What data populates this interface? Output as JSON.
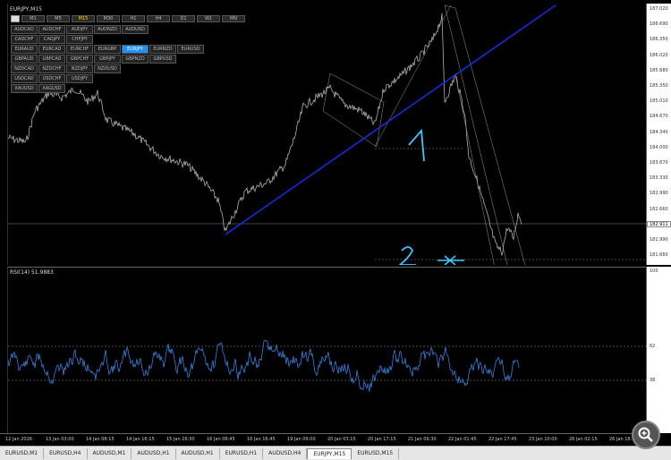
{
  "chart": {
    "title": "EURJPY,M15",
    "timeframes": [
      "M1",
      "M5",
      "M15",
      "M30",
      "H1",
      "H4",
      "D1",
      "W1",
      "MN"
    ],
    "active_timeframe": "M15",
    "pairs": [
      [
        "AUDCAD",
        "AUDCHF",
        "AUDJPY",
        "AUDNZD",
        "AUDUSD"
      ],
      [
        "CADCHF",
        "CADJPY",
        "CHFJPY"
      ],
      [
        "EURAUD",
        "EURCAD",
        "EURCHF",
        "EURGBP",
        "EURJPY",
        "EURNZD",
        "EURUSD"
      ],
      [
        "GBPAUD",
        "GBPCAD",
        "GBPCHF",
        "GBPJPY",
        "GBPNZD",
        "GBPUSD"
      ],
      [
        "NZDCAD",
        "NZDCHF",
        "NZDJPY",
        "NZDUSD"
      ],
      [
        "USDCAD",
        "USDCHF",
        "USDJPY"
      ],
      [
        "XAUUSD",
        "XAGUSD"
      ]
    ],
    "active_pair": "EURJPY",
    "price_ticks": [
      "187.020",
      "186.690",
      "186.350",
      "186.020",
      "185.680",
      "185.350",
      "185.010",
      "184.670",
      "184.340",
      "184.000",
      "183.670",
      "183.330",
      "182.990",
      "182.660",
      "182.330",
      "181.990",
      "181.660"
    ],
    "current_price": "182.911",
    "annotations": {
      "one": "1",
      "two": "2",
      "x": "x"
    }
  },
  "rsi": {
    "title": "RSI(14) 51.9883",
    "ticks": [
      "100",
      "62",
      "38",
      "0"
    ]
  },
  "time_axis": [
    "12 Jan 2026",
    "13 Jan 03:00",
    "14 Jan 08:15",
    "14 Jan 16:15",
    "15 Jan 16:30",
    "16 Jan 08:45",
    "16 Jan 16:45",
    "19 Jan 09:00",
    "20 Jan 03:15",
    "20 Jan 17:15",
    "21 Jan 09:30",
    "22 Jan 01:45",
    "22 Jan 17:45",
    "23 Jan 10:00",
    "26 Jan 02:15",
    "26 Jan 18:15"
  ],
  "tabs": [
    "EURUSD,M1",
    "EURUSD,H4",
    "AUDUSD,M1",
    "AUDUSD,H1",
    "AUDUSD,H1",
    "EURUSD,H1",
    "AUDUSD,H4",
    "EURJPY,M15",
    "EURUSD,M15"
  ],
  "active_tab": 7,
  "colors": {
    "trendline": "#1a2bd6",
    "rsi_line": "#3b7fd8",
    "price_line": "#b0b0b0",
    "annotation": "#40c8ff"
  }
}
